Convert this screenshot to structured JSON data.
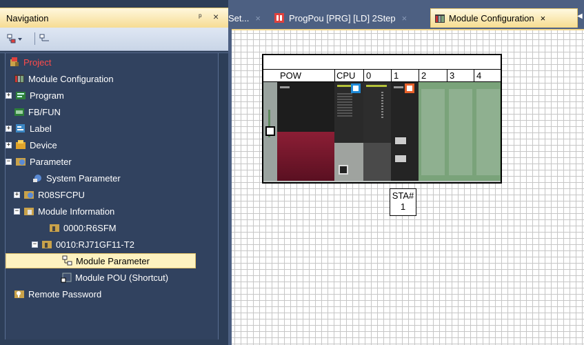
{
  "navigation": {
    "title": "Navigation",
    "pin_glyph": "ᵖ",
    "close_glyph": "×",
    "tree": [
      {
        "label": "Project",
        "icon": "project-icon"
      },
      {
        "label": "Module Configuration",
        "icon": "module-config-icon"
      },
      {
        "label": "Program",
        "icon": "program-icon"
      },
      {
        "label": "FB/FUN",
        "icon": "fbfun-icon"
      },
      {
        "label": "Label",
        "icon": "label-icon"
      },
      {
        "label": "Device",
        "icon": "device-icon"
      },
      {
        "label": "Parameter",
        "icon": "parameter-icon"
      },
      {
        "label": "System Parameter",
        "icon": "system-parameter-icon"
      },
      {
        "label": "R08SFCPU",
        "icon": "cpu-icon"
      },
      {
        "label": "Module Information",
        "icon": "module-info-icon"
      },
      {
        "label": "0000:R6SFM",
        "icon": "module-icon"
      },
      {
        "label": "0010:RJ71GF11-T2",
        "icon": "module-icon"
      },
      {
        "label": "Module Parameter",
        "icon": "module-parameter-icon"
      },
      {
        "label": "Module POU (Shortcut)",
        "icon": "module-pou-icon"
      },
      {
        "label": "Remote Password",
        "icon": "remote-password-icon"
      }
    ]
  },
  "tabs": [
    {
      "label": "Set...",
      "icon": ""
    },
    {
      "label": "ProgPou [PRG] [LD] 2Step",
      "icon": "ladder-program-icon"
    },
    {
      "label": "Module Configuration",
      "icon": "module-config-icon",
      "active": true
    }
  ],
  "tab_close_glyph": "×",
  "rack": {
    "slot_labels": [
      "POW",
      "CPU",
      "0",
      "1",
      "2",
      "3",
      "4"
    ],
    "station_label": "STA#",
    "station_number": "1"
  },
  "colors": {
    "accent_tab": "#f6dc8f",
    "nav_bg": "#2d3e58",
    "project_text": "#ff4b4b",
    "power_module": "#8c1e35",
    "slot_green": "#8fb090",
    "cpu_marker": "#1f8ad6",
    "net_marker": "#e8622a"
  }
}
